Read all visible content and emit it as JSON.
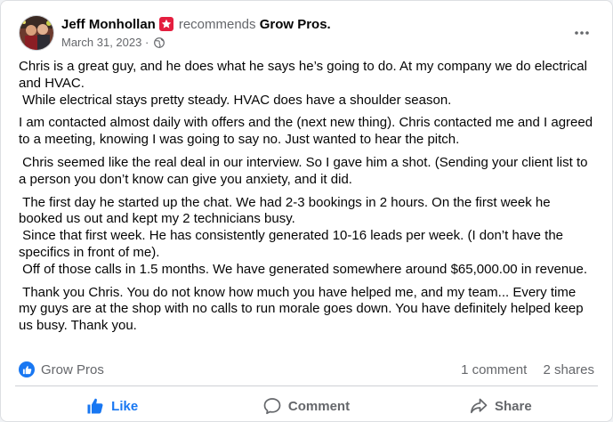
{
  "post": {
    "author": "Jeff Monhollan",
    "action": "recommends",
    "page_name": "Grow Pros.",
    "date": "March 31, 2023",
    "separator": "·",
    "audience_icon": "globe-icon",
    "paragraphs": [
      "Chris is a great guy, and he does what he says he’s going to do. At my company we do electrical and HVAC.\n While electrical stays pretty steady. HVAC does have a shoulder season.",
      "I am contacted almost daily with offers and the (next new thing). Chris contacted me and I agreed to a meeting, knowing I was going to say no. Just wanted to hear the pitch.",
      " Chris seemed like the real deal in our interview. So I gave him a shot. (Sending your client list to a person you don’t know can give you anxiety, and it did.",
      " The first day he started up the chat. We had 2-3 bookings in 2 hours. On the first week he booked us out and kept my 2 technicians busy.\n Since that first week. He has consistently generated 10-16 leads per week. (I don’t have the specifics in front of me).\n Off of those calls in 1.5 months. We have generated somewhere around $65,000.00 in revenue.",
      " Thank you Chris. You do not know how much you have helped me, and my team... Every time my guys are at the shop with no calls to run morale goes down. You have definitely helped keep us busy. Thank you."
    ]
  },
  "reactions": {
    "reactor": "Grow Pros",
    "comments": "1 comment",
    "shares": "2 shares"
  },
  "actions": {
    "like": "Like",
    "comment": "Comment",
    "share": "Share"
  },
  "colors": {
    "accent": "#1877f2",
    "recommend_badge": "#e41e3f",
    "secondary_text": "#65676b"
  }
}
